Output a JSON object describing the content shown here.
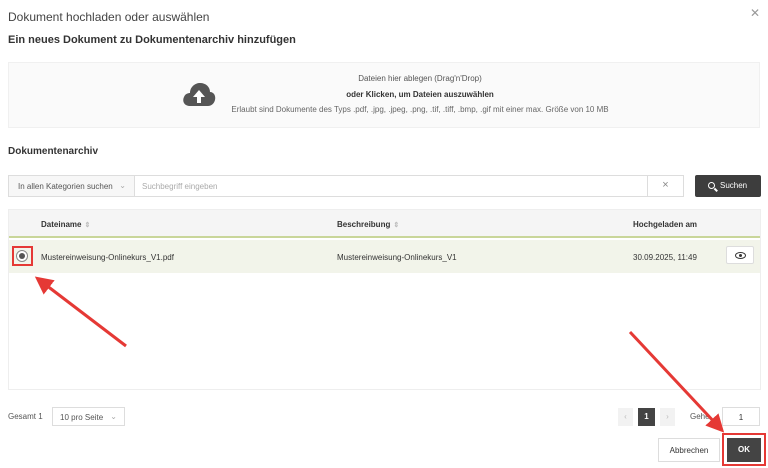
{
  "dialog": {
    "title": "Dokument hochladen oder auswählen",
    "close_icon": "close-icon",
    "subtitle": "Ein neues Dokument zu Dokumentenarchiv hinzufügen"
  },
  "dropzone": {
    "icon": "cloud-upload-icon",
    "line1": "Dateien hier ablegen (Drag'n'Drop)",
    "line2": "oder Klicken, um Dateien auszuwählen",
    "line3": "Erlaubt sind Dokumente des Typs .pdf, .jpg, .jpeg, .png, .tif, .tiff, .bmp, .gif mit einer max. Größe von 10 MB"
  },
  "archive": {
    "section_title": "Dokumentenarchiv",
    "category_select": "In allen Kategorien suchen",
    "search_placeholder": "Suchbegriff eingeben",
    "clear_icon": "×",
    "search_button": "Suchen"
  },
  "table": {
    "columns": [
      "Dateiname",
      "Beschreibung",
      "Hochgeladen am"
    ],
    "rows": [
      {
        "selected": true,
        "filename": "Mustereinweisung-Onlinekurs_V1.pdf",
        "description": "Mustereinweisung-Onlinekurs_V1",
        "uploaded": "30.09.2025, 11:49"
      }
    ]
  },
  "pagination": {
    "total_label": "Gesamt 1",
    "per_page": "10 pro Seite",
    "prev": "‹",
    "current_page": "1",
    "next": "›",
    "goto_label": "Gehe",
    "goto_value": "1"
  },
  "footer": {
    "cancel_label": "Abbrechen",
    "ok_label": "OK"
  },
  "colors": {
    "accent_dark": "#3d3d3d",
    "selected_row": "#f2f4ea",
    "highlight_red": "#e53935"
  }
}
